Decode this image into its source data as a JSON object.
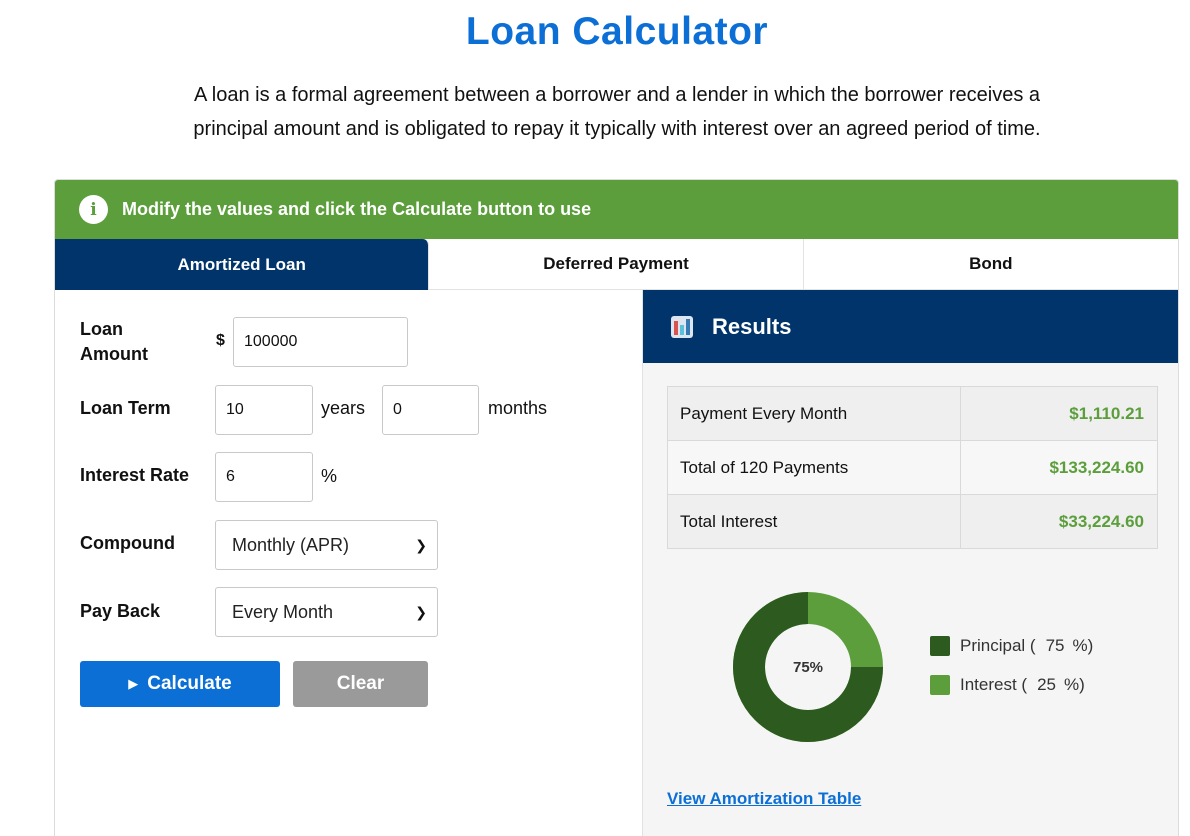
{
  "page": {
    "title": "Loan Calculator",
    "intro_line1": "A loan is a formal agreement between a borrower and a lender in which the borrower receives a",
    "intro_line2": "principal amount and is obligated to repay it typically with interest over an agreed period of time."
  },
  "banner": {
    "icon": "info-icon",
    "text": "Modify the values and click the Calculate button to use"
  },
  "tabs": [
    {
      "label": "Amortized Loan",
      "active": true
    },
    {
      "label": "Deferred Payment",
      "active": false
    },
    {
      "label": "Bond",
      "active": false
    }
  ],
  "form": {
    "loan_amount_label_1": "Loan",
    "loan_amount_label_2": "Amount",
    "currency_symbol": "$",
    "loan_amount_value": "100000",
    "loan_term_label": "Loan Term",
    "years_value": "10",
    "years_unit": "years",
    "months_value": "0",
    "months_unit": "months",
    "interest_rate_label": "Interest Rate",
    "interest_rate_value": "6",
    "percent_unit": "%",
    "compound_label": "Compound",
    "compound_selected": "Monthly (APR)",
    "payback_label": "Pay Back",
    "payback_selected": "Every Month",
    "calculate_label": "Calculate",
    "clear_label": "Clear"
  },
  "results": {
    "title": "Results",
    "rows": [
      {
        "label": "Payment Every Month",
        "value": "$1,110.21"
      },
      {
        "label": "Total of 120 Payments",
        "value": "$133,224.60"
      },
      {
        "label": "Total Interest",
        "value": "$33,224.60"
      }
    ],
    "donut_center": "75%",
    "principal_fraction": 0.75,
    "legend": [
      {
        "prefix": "Principal (",
        "pct": "75",
        "suffix": "%)",
        "color": "#2d5a1e"
      },
      {
        "prefix": "Interest (",
        "pct": "25",
        "suffix": "%)",
        "color": "#5b9e3b"
      }
    ],
    "amortization_link": "View Amortization Table"
  },
  "colors": {
    "brand_blue": "#0b6fd6",
    "navy": "#00346a",
    "banner_green": "#5b9e3b",
    "dark_green": "#2d5a1e"
  }
}
